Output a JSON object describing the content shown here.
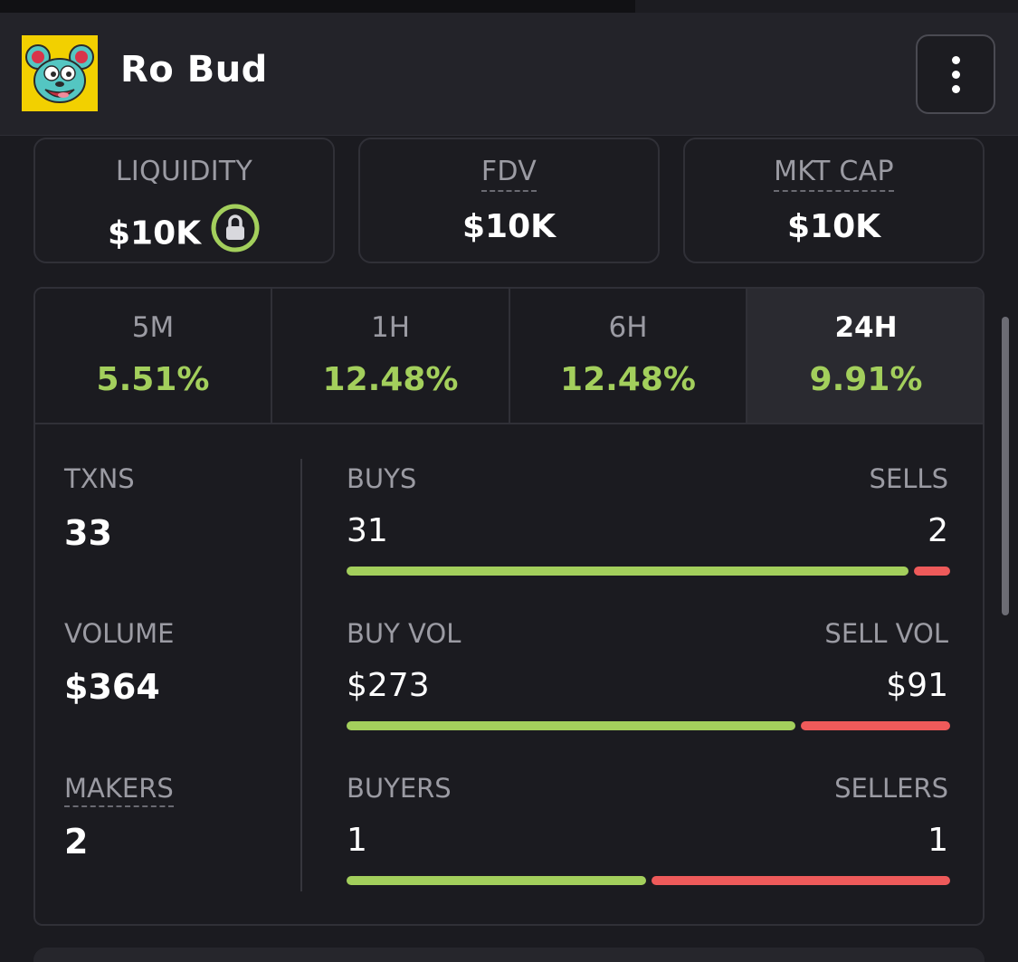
{
  "header": {
    "token_name": "Ro Bud",
    "menu_icon": "more-vertical-icon"
  },
  "stats": [
    {
      "label": "LIQUIDITY",
      "value": "$10K",
      "locked": true
    },
    {
      "label": "FDV",
      "value": "$10K"
    },
    {
      "label": "MKT CAP",
      "value": "$10K"
    }
  ],
  "timeframes": [
    {
      "label": "5M",
      "change": "5.51%"
    },
    {
      "label": "1H",
      "change": "12.48%"
    },
    {
      "label": "6H",
      "change": "12.48%"
    },
    {
      "label": "24H",
      "change": "9.91%",
      "active": true
    }
  ],
  "metrics": {
    "txns": {
      "label": "TXNS",
      "value": "33"
    },
    "volume": {
      "label": "VOLUME",
      "value": "$364"
    },
    "makers": {
      "label": "MAKERS",
      "value": "2"
    }
  },
  "rows": [
    {
      "left_label": "BUYS",
      "right_label": "SELLS",
      "left_value": "31",
      "right_value": "2",
      "buy": 31,
      "sell": 2
    },
    {
      "left_label": "BUY VOL",
      "right_label": "SELL VOL",
      "left_value": "$273",
      "right_value": "$91",
      "buy": 273,
      "sell": 91
    },
    {
      "left_label": "BUYERS",
      "right_label": "SELLERS",
      "left_value": "1",
      "right_value": "1",
      "buy": 1,
      "sell": 1
    }
  ],
  "colors": {
    "positive": "#a3cf5c",
    "negative": "#ee5a5a",
    "lock_ring": "#a3cf5c"
  }
}
